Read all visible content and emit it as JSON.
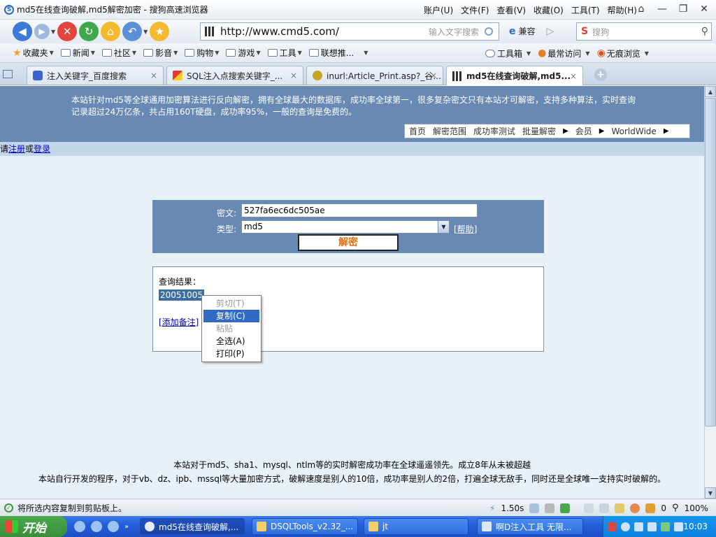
{
  "window": {
    "title": "md5在线查询破解,md5解密加密 - 搜狗高速浏览器",
    "menus": [
      "账户(U)",
      "文件(F)",
      "查看(V)",
      "收藏(O)",
      "工具(T)",
      "帮助(H)"
    ]
  },
  "navbar": {
    "url": "http://www.cmd5.com/",
    "address_hint": "输入文字搜索",
    "compat_label": "兼容",
    "search_placeholder": "搜狗"
  },
  "bookmarks": {
    "items": [
      "收藏夹",
      "新闻",
      "社区",
      "影音",
      "购物",
      "游戏",
      "工具",
      "联想推..."
    ],
    "right_items": [
      "工具箱",
      "最常访问",
      "无痕浏览"
    ]
  },
  "tabs": [
    {
      "label": "注入关键字_百度搜索"
    },
    {
      "label": "SQL注入点搜索关键字_..."
    },
    {
      "label": "inurl:Article_Print.asp?_谷..."
    },
    {
      "label": "md5在线查询破解,md5..."
    }
  ],
  "page": {
    "banner_text": "本站针对md5等全球通用加密算法进行反向解密，拥有全球最大的数据库，成功率全球第一，很多复杂密文只有本站才可解密，支持多种算法，实时查询记录超过24万亿条，共占用160T硬盘，成功率95%，一般的查询是免费的。",
    "nav": [
      "首页",
      "解密范围",
      "成功率测试",
      "批量解密",
      "会员",
      "WorldWide"
    ],
    "login_prefix": "请",
    "login_register": "注册",
    "login_or": "或",
    "login_login": "登录",
    "form": {
      "cipher_label": "密文:",
      "cipher_value": "527fa6ec6dc505ae",
      "type_label": "类型:",
      "type_value": "md5",
      "help_label": "[帮助]",
      "decrypt_label": "解密"
    },
    "result": {
      "title": "查询结果：",
      "value": "20051005",
      "add_note": "[添加备注]"
    },
    "context_menu": [
      {
        "label": "剪切(T)",
        "state": "disabled"
      },
      {
        "label": "复制(C)",
        "state": "hover"
      },
      {
        "label": "粘贴",
        "state": "disabled"
      },
      {
        "label": "全选(A)",
        "state": "normal"
      },
      {
        "label": "打印(P)",
        "state": "normal"
      }
    ],
    "footer_line1": "本站对于md5、sha1、mysql、ntlm等的实时解密成功率在全球遥遥领先。成立8年从未被超越",
    "footer_line2": "本站自行开发的程序，对于vb、dz、ipb、mssql等大量加密方式，破解速度是别人的10倍，成功率是别人的2倍，打遍全球无敌手，同时还是全球唯一支持实时破解的。"
  },
  "statusbar": {
    "text": "将所选内容复制到剪贴板上。",
    "speed": "1.50s",
    "count": "0",
    "zoom": "100%"
  },
  "taskbar": {
    "start_label": "开始",
    "tasks": [
      {
        "label": "md5在线查询破解,..."
      },
      {
        "label": "DSQLTools_v2.32_..."
      },
      {
        "label": "jt"
      },
      {
        "label": "啊D注入工具 无限..."
      }
    ],
    "clock": "10:03"
  },
  "colors": {
    "banner": "#6789b4",
    "page_bg": "#e8f0f8",
    "selection": "#316ac5",
    "decrypt_text": "#e07010"
  }
}
